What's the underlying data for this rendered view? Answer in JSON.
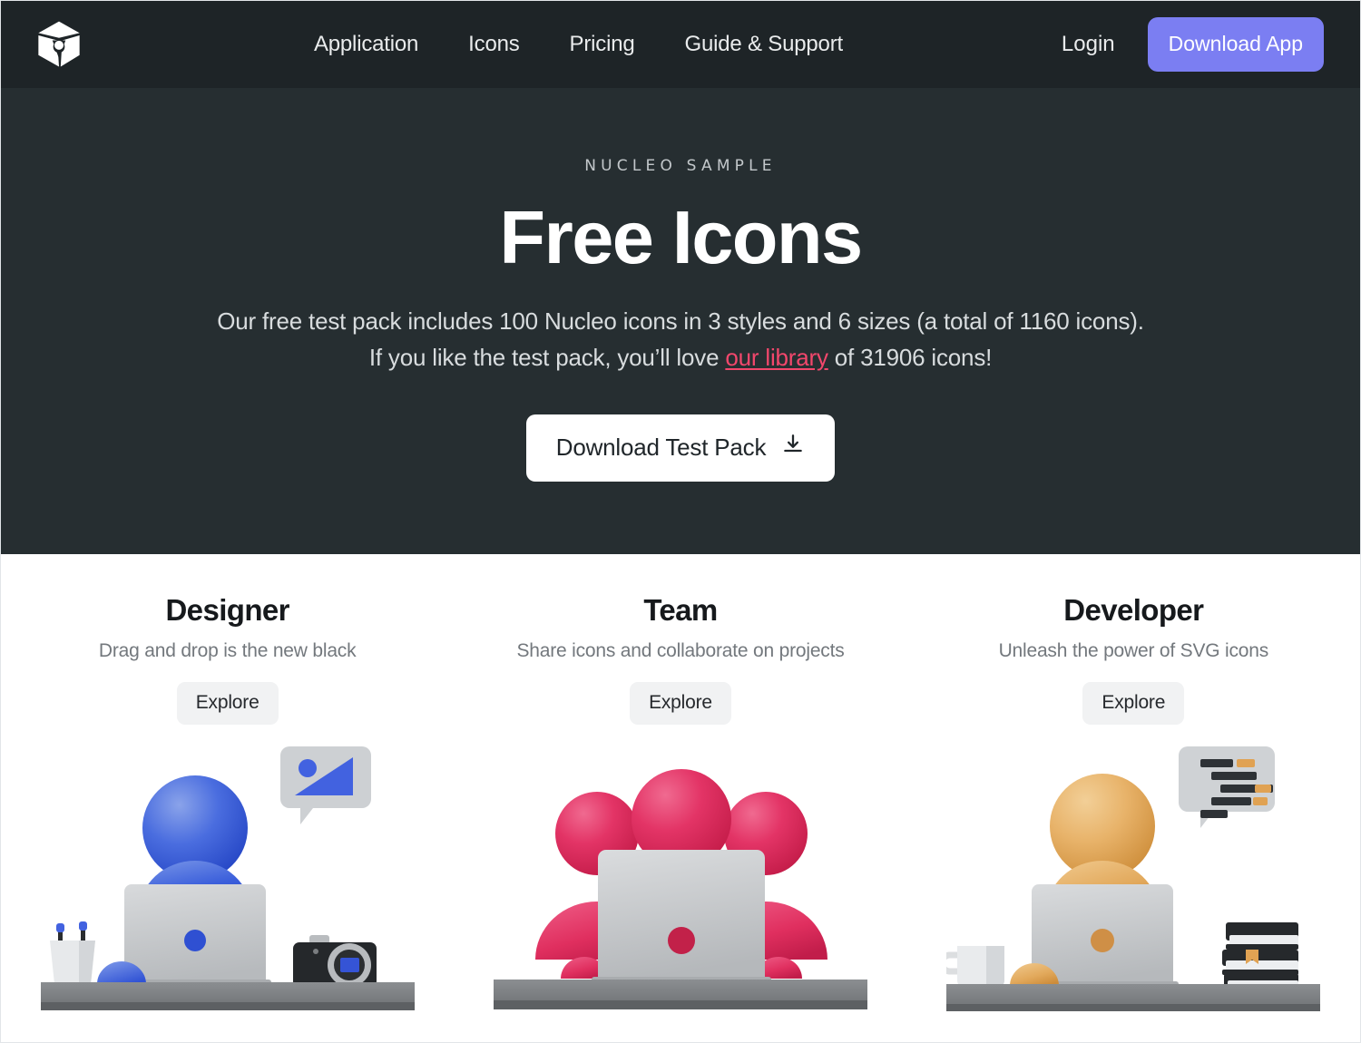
{
  "navbar": {
    "logo_icon": "nucleo-cube-logo-icon",
    "links": [
      {
        "label": "Application"
      },
      {
        "label": "Icons"
      },
      {
        "label": "Pricing"
      },
      {
        "label": "Guide & Support"
      }
    ],
    "login_label": "Login",
    "download_app_label": "Download App",
    "download_app_color": "#7b7ef2",
    "background_color": "#1e2427"
  },
  "hero": {
    "eyebrow": "NUCLEO SAMPLE",
    "title": "Free Icons",
    "description_part1": "Our free test pack includes 100 Nucleo icons in 3 styles and 6 sizes (a total of 1160 icons). If you like the test pack, you’ll love ",
    "link_label": "our library",
    "description_part2": " of 31906 icons!",
    "link_color": "#f2476c",
    "cta_label": "Download Test Pack",
    "cta_icon": "download-icon",
    "background_color": "#262e31"
  },
  "cards": [
    {
      "title": "Designer",
      "subtitle": "Drag and drop is the new black",
      "button_label": "Explore",
      "accent_color": "#3355d8",
      "illustration": "designer-desk-illustration"
    },
    {
      "title": "Team",
      "subtitle": "Share icons and collaborate on projects",
      "button_label": "Explore",
      "accent_color": "#e2315f",
      "illustration": "team-desk-illustration"
    },
    {
      "title": "Developer",
      "subtitle": "Unleash the power of SVG icons",
      "button_label": "Explore",
      "accent_color": "#e0a253",
      "illustration": "developer-desk-illustration"
    }
  ]
}
